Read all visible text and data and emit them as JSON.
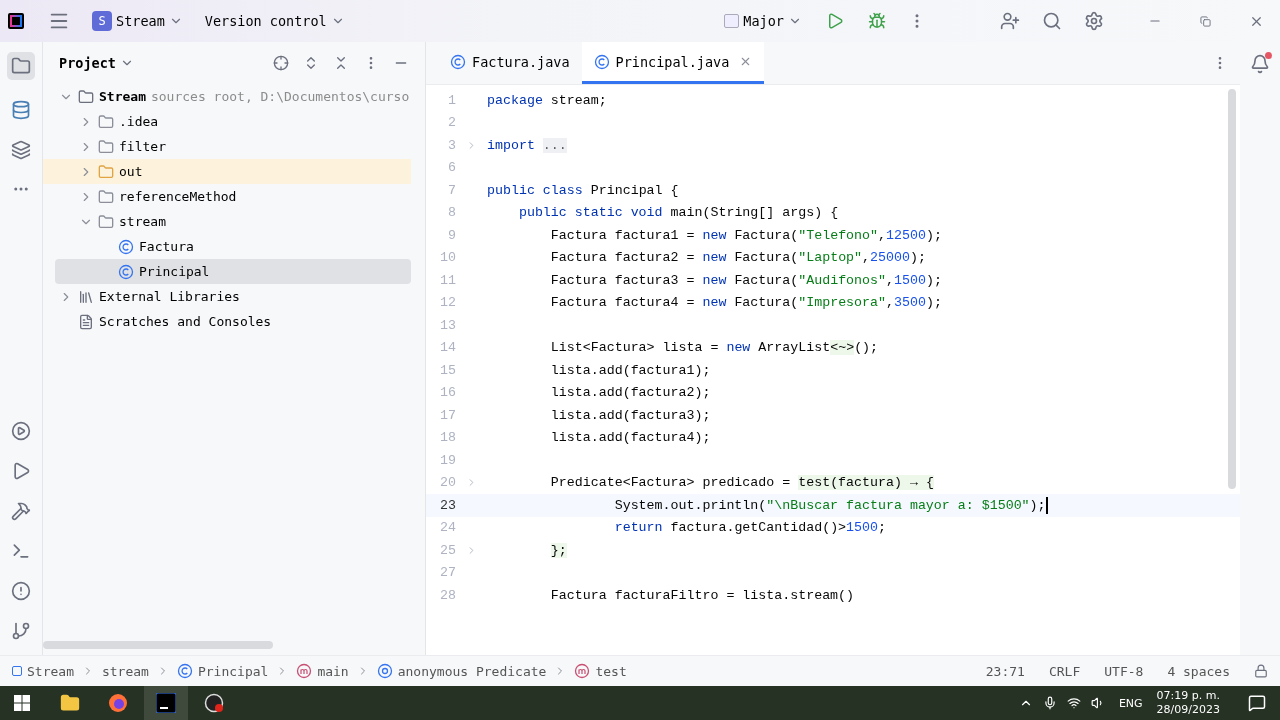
{
  "title_bar": {
    "project_badge": "S",
    "project": "Stream",
    "vcs": "Version control",
    "run_config": "Major"
  },
  "project_panel": {
    "title": "Project",
    "tree": [
      {
        "name": "Stream",
        "hint": "sources root, D:\\Documentos\\curso",
        "kind": "module",
        "expanded": true,
        "selected": false,
        "children": [
          {
            "name": ".idea",
            "kind": "folder",
            "expanded": false,
            "selected": false
          },
          {
            "name": "filter",
            "kind": "package",
            "expanded": false,
            "selected": false
          },
          {
            "name": "out",
            "kind": "excluded",
            "expanded": false,
            "selected": false
          },
          {
            "name": "referenceMethod",
            "kind": "package",
            "expanded": false,
            "selected": false
          },
          {
            "name": "stream",
            "kind": "package",
            "expanded": true,
            "selected": false,
            "children": [
              {
                "name": "Factura",
                "kind": "class",
                "selected": false
              },
              {
                "name": "Principal",
                "kind": "class",
                "selected": true
              }
            ]
          }
        ]
      },
      {
        "name": "External Libraries",
        "kind": "library",
        "expanded": false,
        "selected": false
      },
      {
        "name": "Scratches and Consoles",
        "kind": "scratches",
        "selected": false
      }
    ]
  },
  "editor": {
    "tabs": [
      {
        "label": "Factura.java",
        "selected": false
      },
      {
        "label": "Principal.java",
        "selected": true
      }
    ],
    "lines": [
      {
        "number": "1",
        "current": false,
        "foldable": false,
        "tokens": [
          {
            "kind": "keyword",
            "text": "package"
          },
          {
            "kind": "plain",
            "text": " stream;"
          }
        ]
      },
      {
        "number": "2",
        "current": false,
        "foldable": false
      },
      {
        "number": "3",
        "current": false,
        "foldable": true,
        "tokens": [
          {
            "kind": "keyword",
            "text": "import "
          },
          {
            "kind": "folded",
            "text": "..."
          }
        ]
      },
      {
        "number": "6",
        "current": false,
        "foldable": false
      },
      {
        "number": "7",
        "current": false,
        "foldable": false,
        "tokens": [
          {
            "kind": "keyword",
            "text": "public class"
          },
          {
            "kind": "plain",
            "text": " Principal {"
          }
        ]
      },
      {
        "number": "8",
        "current": false,
        "foldable": false,
        "tokens": [
          {
            "kind": "keyword",
            "text": "    public static void"
          },
          {
            "kind": "plain",
            "text": " main(String[] args) {"
          }
        ]
      },
      {
        "number": "9",
        "current": false,
        "foldable": false,
        "tokens": [
          {
            "kind": "plain",
            "text": "        Factura factura1 = "
          },
          {
            "kind": "keyword",
            "text": "new"
          },
          {
            "kind": "plain",
            "text": " Factura("
          },
          {
            "kind": "string",
            "text": "\"Telefono\""
          },
          {
            "kind": "plain",
            "text": ","
          },
          {
            "kind": "number",
            "text": "12500"
          },
          {
            "kind": "plain",
            "text": ");"
          }
        ]
      },
      {
        "number": "10",
        "current": false,
        "foldable": false,
        "tokens": [
          {
            "kind": "plain",
            "text": "        Factura factura2 = "
          },
          {
            "kind": "keyword",
            "text": "new"
          },
          {
            "kind": "plain",
            "text": " Factura("
          },
          {
            "kind": "string",
            "text": "\"Laptop\""
          },
          {
            "kind": "plain",
            "text": ","
          },
          {
            "kind": "number",
            "text": "25000"
          },
          {
            "kind": "plain",
            "text": ");"
          }
        ]
      },
      {
        "number": "11",
        "current": false,
        "foldable": false,
        "tokens": [
          {
            "kind": "plain",
            "text": "        Factura factura3 = "
          },
          {
            "kind": "keyword",
            "text": "new"
          },
          {
            "kind": "plain",
            "text": " Factura("
          },
          {
            "kind": "string",
            "text": "\"Audifonos\""
          },
          {
            "kind": "plain",
            "text": ","
          },
          {
            "kind": "number",
            "text": "1500"
          },
          {
            "kind": "plain",
            "text": ");"
          }
        ]
      },
      {
        "number": "12",
        "current": false,
        "foldable": false,
        "tokens": [
          {
            "kind": "plain",
            "text": "        Factura factura4 = "
          },
          {
            "kind": "keyword",
            "text": "new"
          },
          {
            "kind": "plain",
            "text": " Factura("
          },
          {
            "kind": "string",
            "text": "\"Impresora\""
          },
          {
            "kind": "plain",
            "text": ","
          },
          {
            "kind": "number",
            "text": "3500"
          },
          {
            "kind": "plain",
            "text": ");"
          }
        ]
      },
      {
        "number": "13",
        "current": false,
        "foldable": false
      },
      {
        "number": "14",
        "current": false,
        "foldable": false,
        "tokens": [
          {
            "kind": "plain",
            "text": "        List<Factura> lista = "
          },
          {
            "kind": "keyword",
            "text": "new"
          },
          {
            "kind": "plain",
            "text": " ArrayList"
          },
          {
            "kind": "folded-code",
            "text": "<~>"
          },
          {
            "kind": "plain",
            "text": "();"
          }
        ]
      },
      {
        "number": "15",
        "current": false,
        "foldable": false,
        "tokens": [
          {
            "kind": "plain",
            "text": "        lista.add(factura1);"
          }
        ]
      },
      {
        "number": "16",
        "current": false,
        "foldable": false,
        "tokens": [
          {
            "kind": "plain",
            "text": "        lista.add(factura2);"
          }
        ]
      },
      {
        "number": "17",
        "current": false,
        "foldable": false,
        "tokens": [
          {
            "kind": "plain",
            "text": "        lista.add(factura3);"
          }
        ]
      },
      {
        "number": "18",
        "current": false,
        "foldable": false,
        "tokens": [
          {
            "kind": "plain",
            "text": "        lista.add(factura4);"
          }
        ]
      },
      {
        "number": "19",
        "current": false,
        "foldable": false
      },
      {
        "number": "20",
        "current": false,
        "foldable": true,
        "tokens": [
          {
            "kind": "plain",
            "text": "        Predicate<Factura> predicado = "
          },
          {
            "kind": "folded-code",
            "text": "test(factura) → {"
          }
        ]
      },
      {
        "number": "23",
        "current": true,
        "foldable": false,
        "tokens": [
          {
            "kind": "plain",
            "text": "                System.out.println("
          },
          {
            "kind": "string",
            "text": "\"\\nBuscar factura mayor a: $1500\""
          },
          {
            "kind": "plain",
            "text": ");"
          }
        ]
      },
      {
        "number": "24",
        "current": false,
        "foldable": false,
        "tokens": [
          {
            "kind": "keyword",
            "text": "                return"
          },
          {
            "kind": "plain",
            "text": " factura.getCantidad()>"
          },
          {
            "kind": "number",
            "text": "1500"
          },
          {
            "kind": "plain",
            "text": ";"
          }
        ]
      },
      {
        "number": "25",
        "current": false,
        "foldable": true,
        "tokens": [
          {
            "kind": "folded-code",
            "text": "        };"
          }
        ]
      },
      {
        "number": "27",
        "current": false,
        "foldable": false
      },
      {
        "number": "28",
        "current": false,
        "foldable": false,
        "tokens": [
          {
            "kind": "plain",
            "text": "        Factura facturaFiltro = lista.stream()"
          }
        ]
      }
    ]
  },
  "breadcrumbs": [
    {
      "label": "Stream",
      "kind": "module"
    },
    {
      "label": "stream",
      "kind": "package"
    },
    {
      "label": "Principal",
      "kind": "class"
    },
    {
      "label": "main",
      "kind": "method"
    },
    {
      "label": "anonymous Predicate",
      "kind": "anonymous"
    },
    {
      "label": "test",
      "kind": "method"
    }
  ],
  "status": [
    "23:71",
    "CRLF",
    "UTF-8",
    "4 spaces"
  ],
  "taskbar": {
    "language": "ENG",
    "time": "07:19 p. m.",
    "date": "28/09/2023"
  }
}
